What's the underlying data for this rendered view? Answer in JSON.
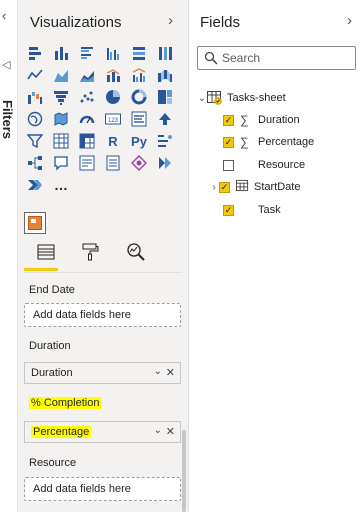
{
  "filters": {
    "label": "Filters"
  },
  "visualizations": {
    "title": "Visualizations",
    "gallery": [
      "stacked-bar-icon",
      "stacked-column-icon",
      "clustered-bar-icon",
      "clustered-column-icon",
      "100-bar-icon",
      "100-column-icon",
      "line-chart-icon",
      "area-chart-icon",
      "stacked-area-icon",
      "line-column-icon",
      "line-clustered-icon",
      "ribbon-chart-icon",
      "waterfall-icon",
      "funnel-icon",
      "scatter-icon",
      "pie-icon",
      "donut-icon",
      "treemap-icon",
      "map-icon",
      "filled-map-icon",
      "gauge-icon",
      "card-icon",
      "multirow-card-icon",
      "kpi-icon",
      "slicer-icon",
      "table-icon",
      "matrix-icon",
      "r-visual-icon",
      "python-visual-icon",
      "key-influencers-icon",
      "decomposition-tree-icon",
      "qa-icon",
      "narrative-icon",
      "paginated-icon",
      "custom-visual-icon",
      "power-apps-icon",
      "power-automate-icon",
      "more-icon"
    ],
    "gallery_glyphs": {
      "r": "R",
      "py": "Py",
      "more": "…",
      "card": "123"
    },
    "wells": {
      "end_date": {
        "label": "End Date",
        "placeholder": "Add data fields here"
      },
      "duration": {
        "label": "Duration",
        "value": "Duration"
      },
      "completion": {
        "label": "% Completion",
        "value": "Percentage"
      },
      "resource": {
        "label": "Resource",
        "placeholder": "Add data fields here"
      }
    }
  },
  "fields": {
    "title": "Fields",
    "search": {
      "placeholder": "Search"
    },
    "table": {
      "name": "Tasks-sheet"
    },
    "items": [
      {
        "label": "Duration",
        "checked": true,
        "sigma": true
      },
      {
        "label": "Percentage",
        "checked": true,
        "sigma": true
      },
      {
        "label": "Resource",
        "checked": false,
        "sigma": false
      },
      {
        "label": "StartDate",
        "checked": true,
        "sigma": false,
        "expandable": true
      },
      {
        "label": "Task",
        "checked": true,
        "sigma": false
      }
    ]
  },
  "colors": {
    "accent": "#f2c811",
    "highlight": "#ffff00",
    "pane_bg": "#f3f2f1",
    "icon_blue": "#2b579a"
  }
}
